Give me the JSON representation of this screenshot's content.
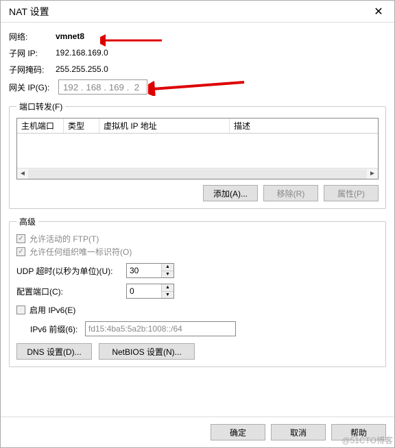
{
  "title": "NAT 设置",
  "network": {
    "label": "网络:",
    "value": "vmnet8"
  },
  "subnet_ip": {
    "label": "子网 IP:",
    "value": "192.168.169.0"
  },
  "subnet_mask": {
    "label": "子网掩码:",
    "value": "255.255.255.0"
  },
  "gateway": {
    "label": "网关 IP(G):",
    "value": "192 . 168 . 169 .  2"
  },
  "port_forward": {
    "legend": "端口转发(F)",
    "columns": {
      "host_port": "主机端口",
      "type": "类型",
      "vm_ip": "虚拟机 IP 地址",
      "desc": "描述"
    },
    "buttons": {
      "add": "添加(A)...",
      "remove": "移除(R)",
      "props": "属性(P)"
    }
  },
  "advanced": {
    "legend": "高级",
    "ftp_label": "允许活动的 FTP(T)",
    "oui_label": "允许任何组织唯一标识符(O)",
    "udp_label": "UDP 超时(以秒为单位)(U):",
    "udp_value": "30",
    "cfg_port_label": "配置端口(C):",
    "cfg_port_value": "0",
    "ipv6_enable_label": "启用 IPv6(E)",
    "ipv6_prefix_label": "IPv6 前缀(6):",
    "ipv6_prefix_value": "fd15:4ba5:5a2b:1008::/64",
    "dns_button": "DNS 设置(D)...",
    "netbios_button": "NetBIOS 设置(N)..."
  },
  "footer": {
    "ok": "确定",
    "cancel": "取消",
    "help": "帮助"
  },
  "watermark": "@51CTO博客"
}
